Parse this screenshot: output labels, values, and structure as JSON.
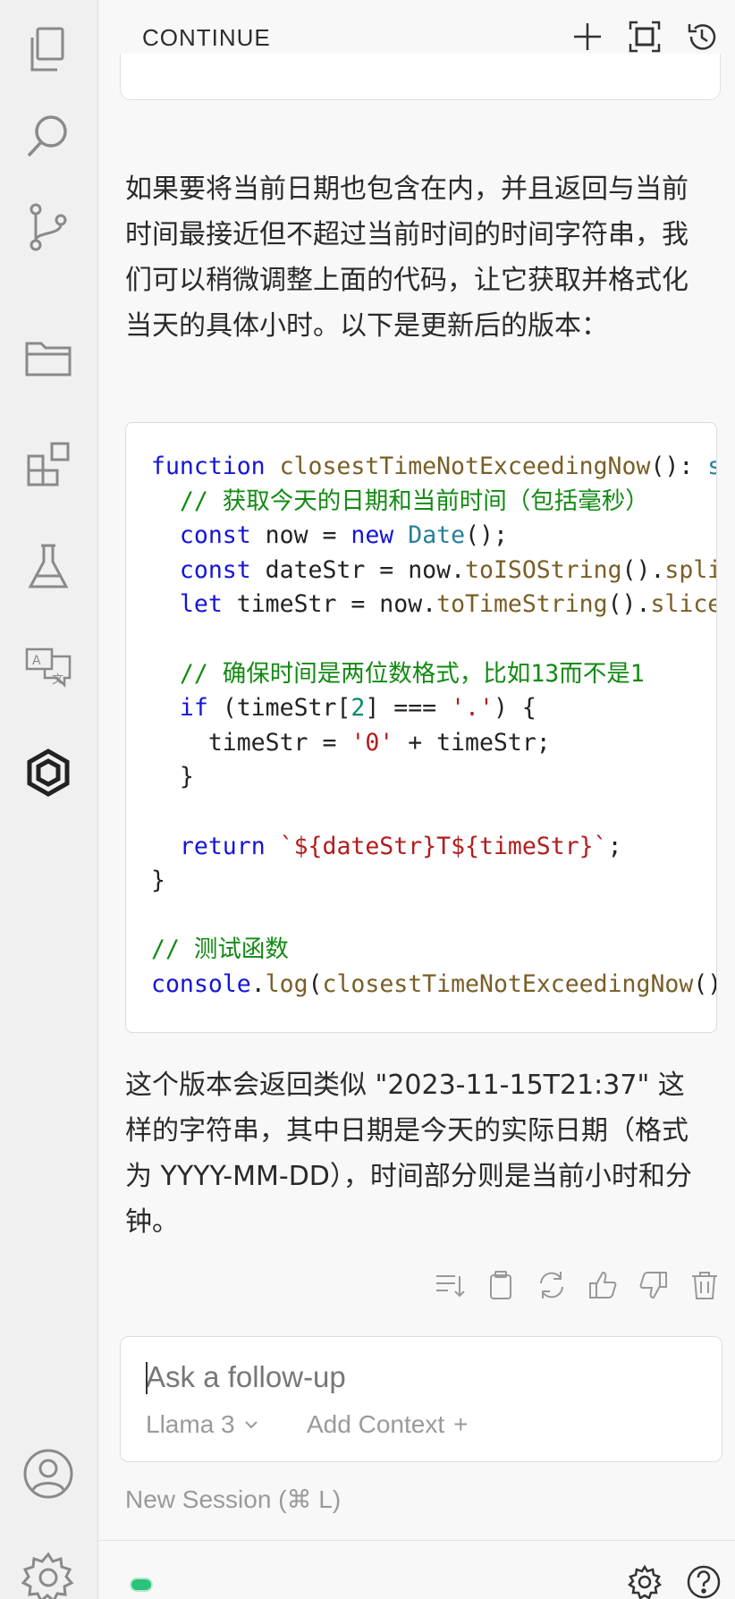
{
  "activity_bar": {
    "items": [
      {
        "icon": "files-icon"
      },
      {
        "icon": "search-icon"
      },
      {
        "icon": "source-control-icon"
      },
      {
        "icon": "folder-icon"
      },
      {
        "icon": "extensions-icon"
      },
      {
        "icon": "flask-icon"
      },
      {
        "icon": "translate-icon"
      },
      {
        "icon": "continue-logo-icon"
      }
    ],
    "bottom": [
      {
        "icon": "account-icon"
      },
      {
        "icon": "settings-gear-icon"
      }
    ]
  },
  "header": {
    "title": "CONTINUE",
    "actions": [
      "new-session-icon",
      "fullscreen-icon",
      "history-icon"
    ]
  },
  "chat": {
    "intro": "如果要将当前日期也包含在内，并且返回与当前时间最接近但不超过当前时间的时间字符串，我们可以稍微调整上面的代码，让它获取并格式化当天的具体小时。以下是更新后的版本：",
    "outro": "这个版本会返回类似 \"2023-11-15T21:37\" 这样的字符串，其中日期是今天的实际日期（格式为 YYYY-MM-DD），时间部分则是当前小时和分钟。",
    "code_language": "typescript",
    "message_actions": [
      "insert-at-cursor-icon",
      "copy-icon",
      "retry-icon",
      "thumbs-up-icon",
      "thumbs-down-icon",
      "delete-icon"
    ]
  },
  "input": {
    "placeholder": "Ask a follow-up",
    "model": "Llama 3",
    "add_context_label": "Add Context",
    "add_context_symbol": "+"
  },
  "new_session_label": "New Session (⌘ L)",
  "colors": {
    "status_indicator": "#29c37a",
    "keyword": "#1515d6",
    "function": "#795e26",
    "comment": "#128a12",
    "string": "#b31c1c"
  }
}
